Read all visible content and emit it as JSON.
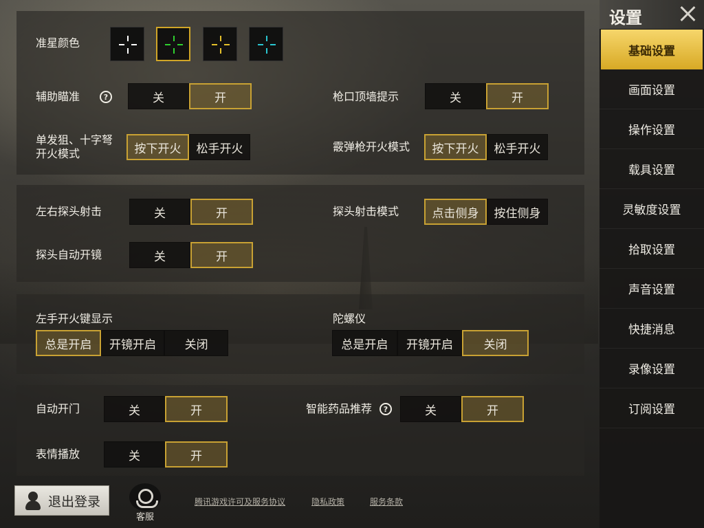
{
  "crosshair": {
    "label": "准星颜色",
    "colors": [
      "#ffffff",
      "#2fd12f",
      "#e6c12a",
      "#2ac6d1"
    ],
    "selected_index": 1
  },
  "aim_assist": {
    "label": "辅助瞄准",
    "help": "?",
    "off": "关",
    "on": "开",
    "value": "开"
  },
  "muzzle_wall": {
    "label": "枪口顶墙提示",
    "off": "关",
    "on": "开",
    "value": "开"
  },
  "single_fire": {
    "label": "单发狙、十字弩开火模式",
    "opt1": "按下开火",
    "opt2": "松手开火",
    "value": "按下开火"
  },
  "shotgun_fire": {
    "label": "霰弹枪开火模式",
    "opt1": "按下开火",
    "opt2": "松手开火",
    "value": "按下开火"
  },
  "peek_fire": {
    "label": "左右探头射击",
    "off": "关",
    "on": "开",
    "value": "开"
  },
  "peek_mode": {
    "label": "探头射击模式",
    "opt1": "点击侧身",
    "opt2": "按住侧身",
    "value": "点击侧身"
  },
  "peek_scope": {
    "label": "探头自动开镜",
    "off": "关",
    "on": "开",
    "value": "开"
  },
  "left_fire": {
    "label": "左手开火键显示",
    "opt1": "总是开启",
    "opt2": "开镜开启",
    "opt3": "关闭",
    "value": "总是开启"
  },
  "gyro": {
    "label": "陀螺仪",
    "opt1": "总是开启",
    "opt2": "开镜开启",
    "opt3": "关闭",
    "value": "关闭"
  },
  "auto_door": {
    "label": "自动开门",
    "off": "关",
    "on": "开",
    "value": "开"
  },
  "smart_med": {
    "label": "智能药品推荐",
    "help": "?",
    "off": "关",
    "on": "开",
    "value": "开"
  },
  "emote": {
    "label": "表情播放",
    "off": "关",
    "on": "开",
    "value": "开"
  },
  "sidebar": {
    "title": "设置",
    "items": [
      {
        "label": "基础设置",
        "active": true
      },
      {
        "label": "画面设置"
      },
      {
        "label": "操作设置"
      },
      {
        "label": "载具设置"
      },
      {
        "label": "灵敏度设置"
      },
      {
        "label": "拾取设置"
      },
      {
        "label": "声音设置"
      },
      {
        "label": "快捷消息"
      },
      {
        "label": "录像设置"
      },
      {
        "label": "订阅设置"
      }
    ]
  },
  "footer": {
    "logout": "退出登录",
    "service": "客服",
    "links": [
      "腾讯游戏许可及服务协议",
      "隐私政策",
      "服务条款"
    ]
  },
  "colors": {
    "accent": "#c9a233",
    "active_tab": "#e8c04a"
  }
}
